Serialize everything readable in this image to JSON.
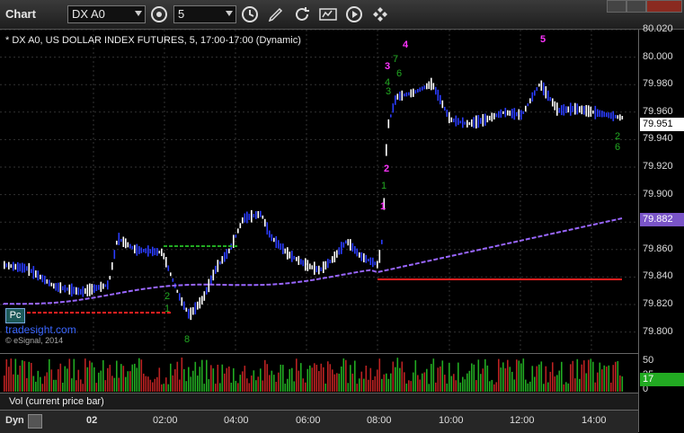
{
  "toolbar": {
    "title": "Chart",
    "symbol": "DX A0",
    "interval": "5",
    "icons": [
      "properties-icon",
      "clock-icon",
      "draw-pencil-icon",
      "refresh-icon",
      "gsl-icon",
      "play-icon",
      "cursor-icon"
    ]
  },
  "chart": {
    "header": "* DX A0, US DOLLAR INDEX FUTURES, 5, 17:00-17:00 (Dynamic)",
    "watermark": "tradesight.com",
    "copyright": "© eSignal, 2014",
    "pc_label": "Pc",
    "y_ticks": [
      "80.020",
      "80.000",
      "79.980",
      "79.960",
      "79.940",
      "79.920",
      "79.900",
      "79.880",
      "79.860",
      "79.840",
      "79.820",
      "79.800"
    ],
    "last_price": "79.951",
    "ma_value": "79.882",
    "x_ticks": [
      "02",
      "02:00",
      "04:00",
      "06:00",
      "08:00",
      "10:00",
      "12:00",
      "14:00"
    ],
    "colors": {
      "up": "#ffffff",
      "down": "#2a3cff",
      "ma": "#9966ff",
      "support": "#ff2020",
      "resistance": "#22aa22",
      "pivot": "#ff33ff",
      "count": "#22aa22"
    }
  },
  "annotations": {
    "pink": [
      "4",
      "3",
      "2",
      "1",
      "5"
    ],
    "green": [
      "7",
      "6",
      "4",
      "3",
      "1",
      "2",
      "1",
      "2",
      "6",
      "8"
    ]
  },
  "volume": {
    "label": "Vol (current price bar)",
    "ticks": [
      "50",
      "25",
      "0"
    ],
    "current": "17"
  },
  "footer": {
    "mode": "Dyn"
  }
}
